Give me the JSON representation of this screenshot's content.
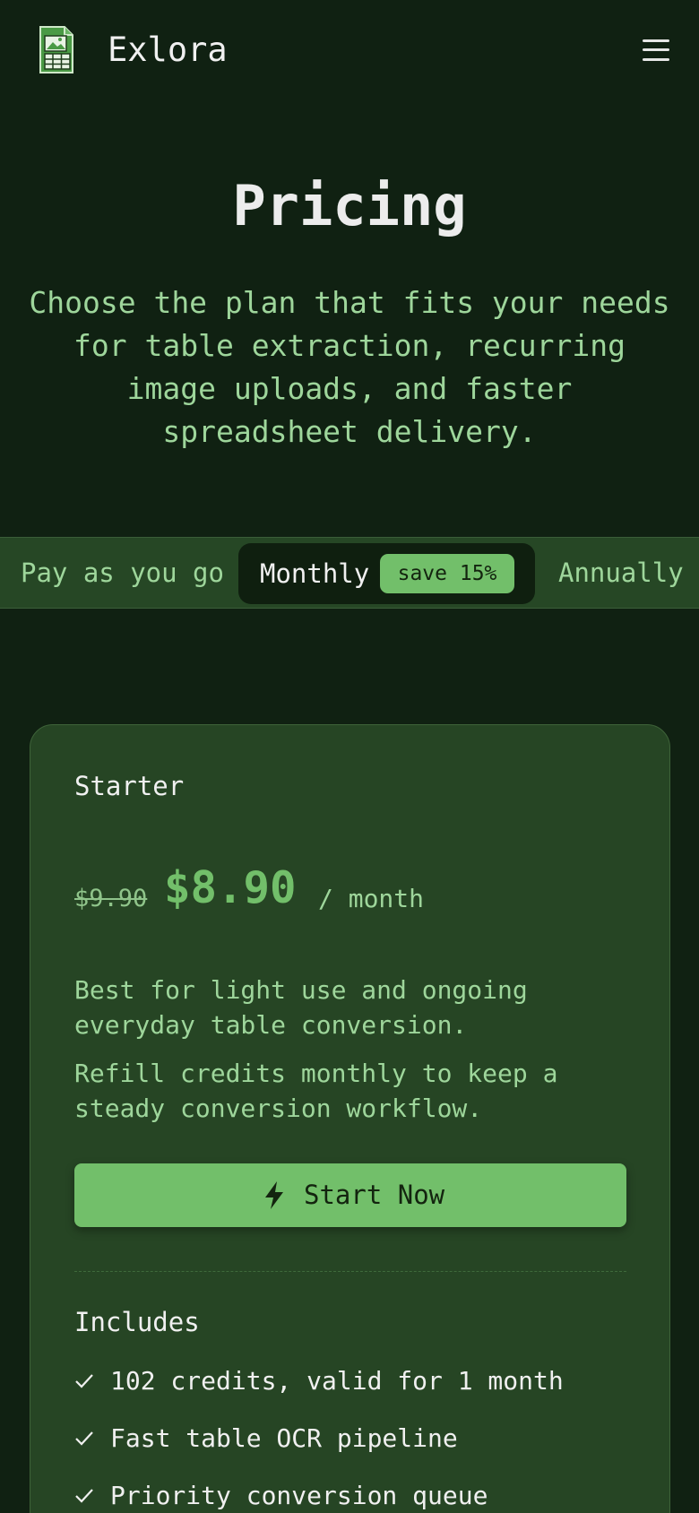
{
  "header": {
    "brand": "Exlora",
    "logo_icon": "spreadsheet-image-logo-icon",
    "menu_icon": "hamburger-menu-icon"
  },
  "hero": {
    "title": "Pricing",
    "subtitle": "Choose the plan that fits your needs for table extraction, recurring image uploads, and faster spreadsheet delivery."
  },
  "billing": {
    "options": [
      "Pay as you go",
      "Monthly",
      "Annually"
    ],
    "selected": "Monthly",
    "save_badge": "save 15%"
  },
  "plan": {
    "name": "Starter",
    "old_price": "$9.90",
    "price": "$8.90",
    "period": "/ month",
    "description_1": "Best for light use and ongoing everyday table conversion.",
    "description_2": "Refill credits monthly to keep a steady conversion workflow.",
    "cta_label": "Start Now",
    "cta_icon": "lightning-bolt-icon",
    "includes_title": "Includes",
    "features": [
      "102 credits, valid for 1 month",
      "Fast table OCR pipeline",
      "Priority conversion queue"
    ]
  },
  "colors": {
    "background": "#102112",
    "card": "#264524",
    "accent": "#72bf6a",
    "muted_text": "#9ed69b"
  }
}
